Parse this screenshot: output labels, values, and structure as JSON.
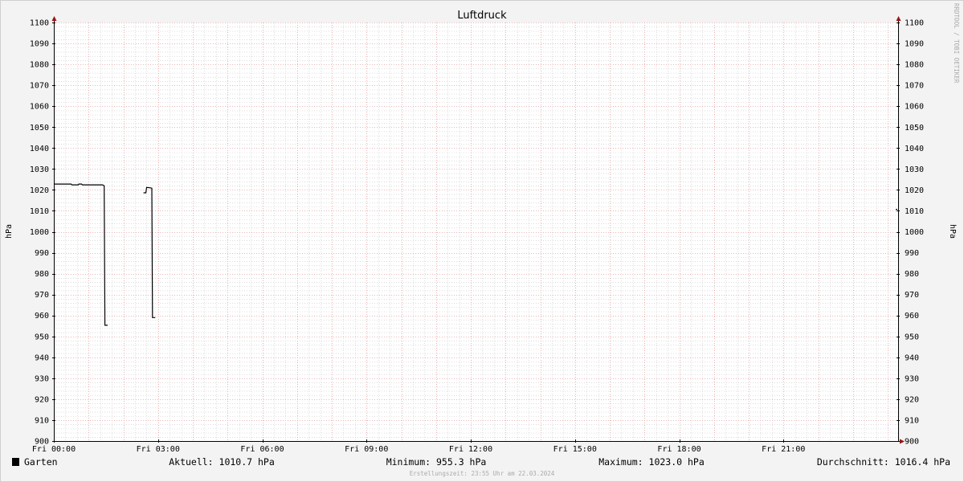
{
  "chart_data": {
    "type": "line",
    "title": "Luftdruck",
    "ylabel": "hPa",
    "ylabel_right": "hPa",
    "watermark": "RRDTOOL / TOBI OETIKER",
    "ylim": [
      900,
      1100
    ],
    "y_ticks": [
      "900",
      "910",
      "920",
      "930",
      "940",
      "950",
      "960",
      "970",
      "980",
      "990",
      "1000",
      "1010",
      "1020",
      "1030",
      "1040",
      "1050",
      "1060",
      "1070",
      "1080",
      "1090",
      "1100"
    ],
    "xlim_hours": [
      0,
      24.3
    ],
    "x_ticks": [
      {
        "label": "Fri 00:00",
        "hour": 0
      },
      {
        "label": "Fri 03:00",
        "hour": 3
      },
      {
        "label": "Fri 06:00",
        "hour": 6
      },
      {
        "label": "Fri 09:00",
        "hour": 9
      },
      {
        "label": "Fri 12:00",
        "hour": 12
      },
      {
        "label": "Fri 15:00",
        "hour": 15
      },
      {
        "label": "Fri 18:00",
        "hour": 18
      },
      {
        "label": "Fri 21:00",
        "hour": 21
      }
    ],
    "grid": true,
    "series": [
      {
        "name": "Garten",
        "color": "#000000",
        "segments": [
          [
            {
              "hour": 0.0,
              "value": 1022.8
            },
            {
              "hour": 0.5,
              "value": 1022.8
            },
            {
              "hour": 0.52,
              "value": 1022.4
            },
            {
              "hour": 0.7,
              "value": 1022.4
            },
            {
              "hour": 0.72,
              "value": 1022.8
            },
            {
              "hour": 0.8,
              "value": 1022.8
            },
            {
              "hour": 0.82,
              "value": 1022.4
            },
            {
              "hour": 1.4,
              "value": 1022.4
            },
            {
              "hour": 1.45,
              "value": 1022.0
            },
            {
              "hour": 1.47,
              "value": 955.3
            },
            {
              "hour": 1.55,
              "value": 955.3
            }
          ],
          [
            {
              "hour": 2.58,
              "value": 1018.6
            },
            {
              "hour": 2.65,
              "value": 1018.6
            },
            {
              "hour": 2.67,
              "value": 1021.2
            },
            {
              "hour": 2.78,
              "value": 1021.0
            },
            {
              "hour": 2.82,
              "value": 1020.8
            },
            {
              "hour": 2.84,
              "value": 959.0
            },
            {
              "hour": 2.92,
              "value": 959.0
            }
          ],
          [
            {
              "hour": 24.23,
              "value": 1010.7
            },
            {
              "hour": 24.28,
              "value": 1010.7
            }
          ]
        ]
      }
    ],
    "legend": {
      "series_name": "Garten",
      "current": "Aktuell: 1010.7 hPa",
      "minimum": "Minimum: 955.3 hPa",
      "maximum": "Maximum: 1023.0 hPa",
      "average": "Durchschnitt: 1016.4 hPa"
    },
    "footer": "Erstellungszeit: 23:55 Uhr am 22.03.2024",
    "colors": {
      "background": "#f3f3f3",
      "plot": "#ffffff",
      "minor_grid": "#c8c8c8",
      "major_grid": "#e6a0a0",
      "axis": "#000000",
      "arrow": "#9a1414"
    }
  }
}
